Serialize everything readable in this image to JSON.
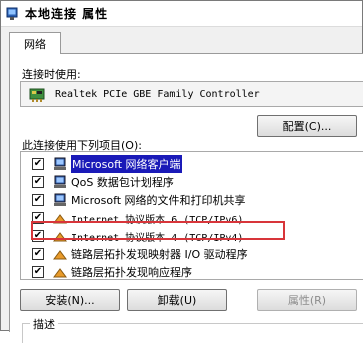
{
  "window": {
    "title": "本地连接 属性"
  },
  "tabs": [
    {
      "label": "网络"
    }
  ],
  "connect_using": {
    "label": "连接时使用:",
    "adapter": "Realtek PCIe GBE Family Controller",
    "configure_label": "配置(C)..."
  },
  "items_section": {
    "label": "此连接使用下列项目(O):",
    "items": [
      {
        "label": "Microsoft 网络客户端",
        "checked": true,
        "icon": "network-client-icon",
        "selected": true
      },
      {
        "label": "QoS 数据包计划程序",
        "checked": true,
        "icon": "qos-icon"
      },
      {
        "label": "Microsoft 网络的文件和打印机共享",
        "checked": true,
        "icon": "file-printer-sharing-icon"
      },
      {
        "label": "Internet 协议版本 6 (TCP/IPv6)",
        "checked": true,
        "icon": "protocol-icon"
      },
      {
        "label": "Internet 协议版本 4 (TCP/IPv4)",
        "checked": true,
        "icon": "protocol-icon",
        "highlighted": true
      },
      {
        "label": "链路层拓扑发现映射器 I/O 驱动程序",
        "checked": true,
        "icon": "protocol-icon"
      },
      {
        "label": "链路层拓扑发现响应程序",
        "checked": true,
        "icon": "protocol-icon"
      }
    ]
  },
  "buttons": {
    "install": "安装(N)...",
    "uninstall": "卸载(U)",
    "properties": "属性(R)"
  },
  "description": {
    "label": "描述"
  },
  "colors": {
    "highlight_border": "#d8353a",
    "selection": "#1a1ab8"
  }
}
